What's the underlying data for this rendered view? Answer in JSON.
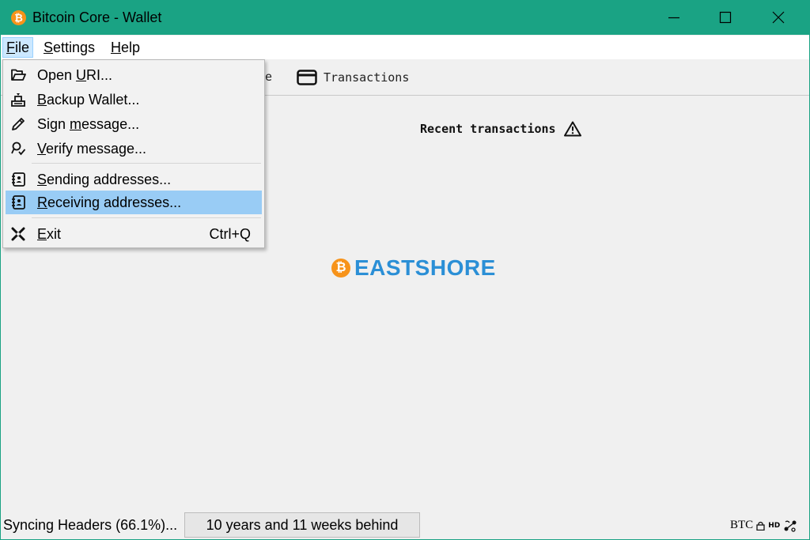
{
  "window": {
    "title": "Bitcoin Core - Wallet",
    "app_icon_glyph": "₿",
    "title_color": "#1aa384"
  },
  "menubar": {
    "items": [
      {
        "label": "File",
        "mnemonic": "F",
        "rest": "ile",
        "active": true
      },
      {
        "label": "Settings",
        "mnemonic": "S",
        "rest": "ettings",
        "active": false
      },
      {
        "label": "Help",
        "mnemonic": "H",
        "rest": "elp",
        "active": false
      }
    ]
  },
  "toolbar": {
    "partial_label": "e",
    "transactions_label": "Transactions"
  },
  "main": {
    "recent_transactions_label": "Recent transactions",
    "watermark_glyph": "₿",
    "watermark_text": "EASTSHORE"
  },
  "file_menu": {
    "items": [
      {
        "pre": "Open ",
        "mn": "U",
        "post": "RI...",
        "icon": "folder-open-icon"
      },
      {
        "pre": "",
        "mn": "B",
        "post": "ackup Wallet...",
        "icon": "backup-wallet-icon"
      },
      {
        "pre": "Sign ",
        "mn": "m",
        "post": "essage...",
        "icon": "pen-icon"
      },
      {
        "pre": "",
        "mn": "V",
        "post": "erify message...",
        "icon": "verify-icon"
      },
      {
        "pre": "",
        "mn": "S",
        "post": "ending addresses...",
        "icon": "address-book-icon"
      },
      {
        "pre": "",
        "mn": "R",
        "post": "eceiving addresses...",
        "icon": "address-book-icon"
      },
      {
        "pre": "",
        "mn": "E",
        "post": "xit",
        "icon": "exit-icon",
        "shortcut": "Ctrl+Q"
      }
    ],
    "highlight_color": "#99ccf5"
  },
  "statusbar": {
    "sync_text": "Syncing Headers (66.1%)...",
    "progress_text": "10 years and 11 weeks behind",
    "unit": "BTC",
    "hd_label": "HD"
  }
}
